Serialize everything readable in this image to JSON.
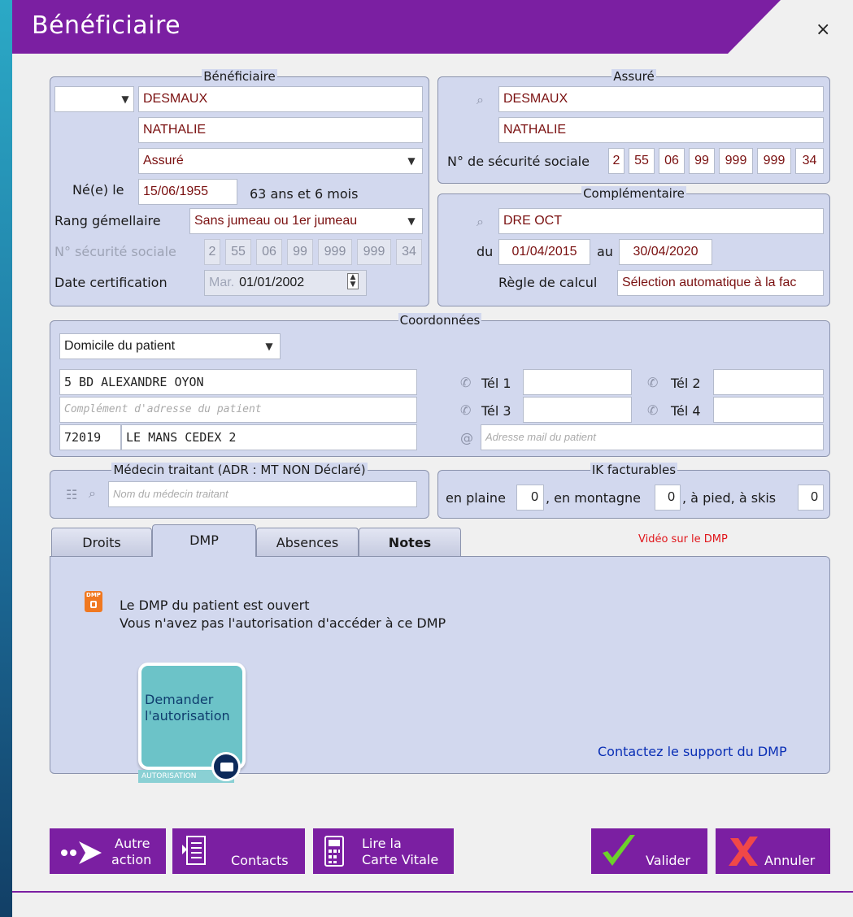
{
  "window": {
    "title": "Bénéficiaire",
    "close": "×"
  },
  "beneficiaire": {
    "group_title": "Bénéficiaire",
    "civilite": "",
    "nom": "DESMAUX",
    "prenom": "NATHALIE",
    "qualite": "Assuré",
    "naissance_label": "Né(e) le",
    "naissance": "15/06/1955",
    "age": "63 ans et 6 mois",
    "rang_label": "Rang gémellaire",
    "rang": "Sans jumeau ou 1er jumeau",
    "nss_label": "N° sécurité sociale",
    "nss": [
      "2",
      "55",
      "06",
      "99",
      "999",
      "999",
      "34"
    ],
    "date_cert_label": "Date certification",
    "date_cert_prefix": "Mar.",
    "date_cert": "01/01/2002"
  },
  "assure": {
    "group_title": "Assuré",
    "nom": "DESMAUX",
    "prenom": "NATHALIE",
    "nss_label": "N° de sécurité sociale",
    "nss": [
      "2",
      "55",
      "06",
      "99",
      "999",
      "999",
      "34"
    ]
  },
  "complementaire": {
    "group_title": "Complémentaire",
    "nom": "DRE OCT",
    "du_label": "du",
    "du": "01/04/2015",
    "au_label": "au",
    "au": "30/04/2020",
    "regle_label": "Règle de calcul",
    "regle": "Sélection automatique à la fac"
  },
  "coordonnees": {
    "group_title": "Coordonnées",
    "lieu": "Domicile du patient",
    "adresse1": "5 BD ALEXANDRE OYON",
    "adresse2_placeholder": "Complément d'adresse du patient",
    "cp": "72019",
    "ville": "LE MANS CEDEX 2",
    "tel1_label": "Tél 1",
    "tel2_label": "Tél 2",
    "tel3_label": "Tél 3",
    "tel4_label": "Tél 4",
    "tel1": "",
    "tel2": "",
    "tel3": "",
    "tel4": "",
    "mail_placeholder": "Adresse mail du patient"
  },
  "medecin": {
    "group_title": "Médecin traitant (ADR : MT NON Déclaré)",
    "placeholder": "Nom du médecin traitant"
  },
  "ik": {
    "group_title": "IK facturables",
    "plaine_label": "en plaine",
    "plaine": "0",
    "montagne_label": ", en montagne",
    "montagne": "0",
    "pied_label": ", à pied, à skis",
    "pied": "0"
  },
  "tabs": [
    {
      "label": "Droits"
    },
    {
      "label": "DMP"
    },
    {
      "label": "Absences"
    },
    {
      "label": "Notes"
    }
  ],
  "video_link": "Vidéo sur le DMP",
  "dmp": {
    "icon_label": "DMP",
    "line1": "Le DMP du patient est ouvert",
    "line2": "Vous n'avez pas l'autorisation d'accéder à ce DMP",
    "card_text": "Demander l'autorisation",
    "card_footer": "AUTORISATION",
    "support_link": "Contactez le support du DMP"
  },
  "buttons": {
    "autre1": "Autre",
    "autre2": "action",
    "contacts": "Contacts",
    "carte1": "Lire la",
    "carte2": "Carte Vitale",
    "valider": "Valider",
    "annuler": "Annuler"
  },
  "colors": {
    "accent": "#7b1fa2",
    "group_bg": "#d2d8ee",
    "field_text": "#7a1010",
    "link": "#0a2fb5",
    "video_link": "#e0161b",
    "card": "#6cc3c8"
  }
}
